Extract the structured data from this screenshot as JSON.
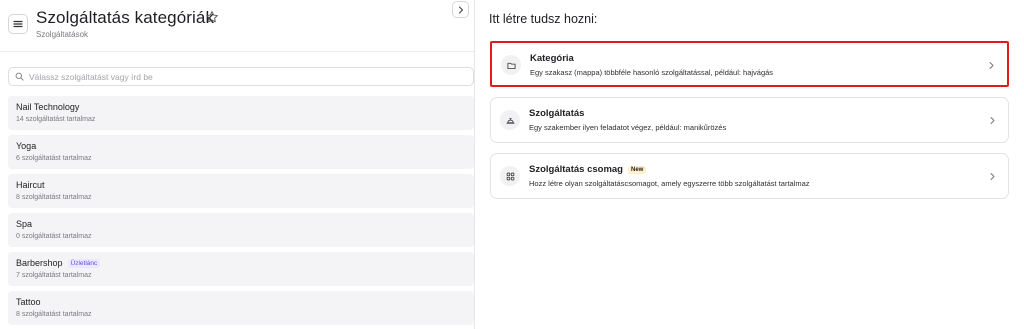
{
  "header": {
    "title": "Szolgáltatás kategóriák",
    "breadcrumb": "Szolgáltatások"
  },
  "search": {
    "placeholder": "Válassz szolgáltatást vagy írd be",
    "value": ""
  },
  "categories": [
    {
      "name": "Nail Technology",
      "count": "14 szolgáltatást tartalmaz",
      "badge": ""
    },
    {
      "name": "Yoga",
      "count": "6 szolgáltatást tartalmaz",
      "badge": ""
    },
    {
      "name": "Haircut",
      "count": "8 szolgáltatást tartalmaz",
      "badge": ""
    },
    {
      "name": "Spa",
      "count": "0 szolgáltatást tartalmaz",
      "badge": ""
    },
    {
      "name": "Barbershop",
      "count": "7 szolgáltatást tartalmaz",
      "badge": "Üzletlánc"
    },
    {
      "name": "Tattoo",
      "count": "8 szolgáltatást tartalmaz",
      "badge": ""
    }
  ],
  "create": {
    "title": "Itt létre tudsz hozni:",
    "options": [
      {
        "title": "Kategória",
        "description": "Egy szakasz (mappa) többféle hasonló szolgáltatással, például: hajvágás",
        "icon": "folder-icon",
        "badge": "",
        "selected": true
      },
      {
        "title": "Szolgáltatás",
        "description": "Egy szakember ilyen feladatot végez, például: manikűrözés",
        "icon": "service-bell-icon",
        "badge": "",
        "selected": false
      },
      {
        "title": "Szolgáltatás csomag",
        "description": "Hozz létre olyan szolgáltatáscsomagot, amely egyszerre több szolgáltatást tartalmaz",
        "icon": "grid-icon",
        "badge": "New",
        "selected": false
      }
    ]
  },
  "colors": {
    "selection_outline": "#e01b1b",
    "chain_badge_text": "#6a4fd8",
    "chain_badge_bg": "#ece8ff",
    "new_badge_bg": "#fff0c9"
  }
}
